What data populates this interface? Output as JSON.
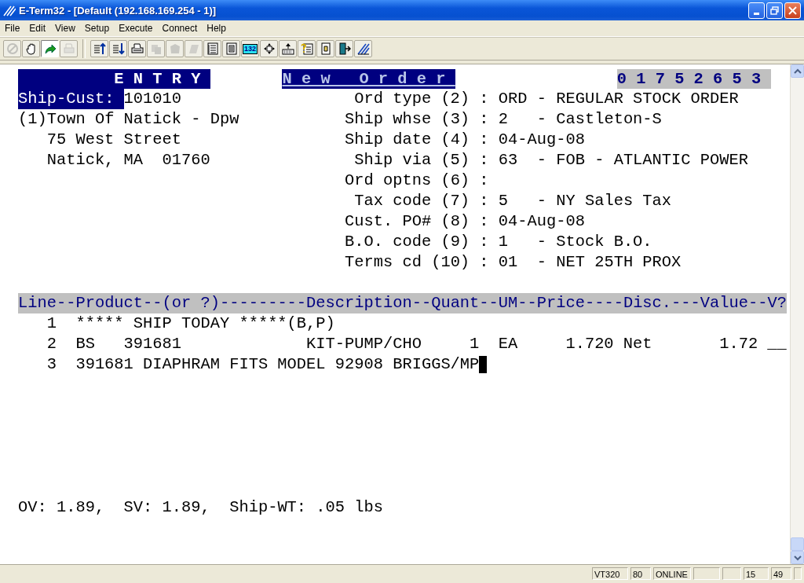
{
  "window": {
    "title": "E-Term32 - [Default (192.168.169.254 - 1)]"
  },
  "menu": [
    "File",
    "Edit",
    "View",
    "Setup",
    "Execute",
    "Connect",
    "Help"
  ],
  "toolbar": {
    "groups": [
      [
        {
          "disabled": true,
          "pressed": false
        },
        {
          "disabled": false,
          "pressed": false
        },
        {
          "disabled": false,
          "pressed": true
        },
        {
          "disabled": true,
          "pressed": false
        }
      ],
      [
        {
          "disabled": false,
          "pressed": false
        },
        {
          "disabled": false,
          "pressed": false
        },
        {
          "disabled": false,
          "pressed": false
        },
        {
          "disabled": true,
          "pressed": false
        },
        {
          "disabled": true,
          "pressed": false
        },
        {
          "disabled": true,
          "pressed": false
        },
        {
          "disabled": false,
          "pressed": false
        },
        {
          "disabled": false,
          "pressed": false
        },
        {
          "disabled": false,
          "pressed": false,
          "label": "132"
        },
        {
          "disabled": false,
          "pressed": false
        },
        {
          "disabled": false,
          "pressed": false
        },
        {
          "disabled": false,
          "pressed": false
        },
        {
          "disabled": false,
          "pressed": false
        },
        {
          "disabled": false,
          "pressed": false
        },
        {
          "disabled": false,
          "pressed": false
        }
      ]
    ]
  },
  "terminal": {
    "banners": [
      "ENTRY",
      "New Order",
      "01752653"
    ],
    "customer": {
      "label": "Ship-Cust:",
      "number": "101010",
      "index": "(1)",
      "name": "Town Of Natick - Dpw",
      "address": [
        "75 West Street",
        "Natick, MA  01760"
      ]
    },
    "fields": [
      {
        "label": "Ord type (2)",
        "separator": ":",
        "value": "ORD - REGULAR STOCK ORDER"
      },
      {
        "label": "Ship whse (3)",
        "separator": ":",
        "value": "2   - Castleton-S"
      },
      {
        "label": "Ship date (4)",
        "separator": ":",
        "value": "04-Aug-08"
      },
      {
        "label": "Ship via (5)",
        "separator": ":",
        "value": "63  - FOB - ATLANTIC POWER"
      },
      {
        "label": "Ord optns (6)",
        "separator": ":"
      },
      {
        "label": "Tax code (7)",
        "separator": ":",
        "value": "5   - NY Sales Tax"
      },
      {
        "label": "Cust. PO# (8)",
        "separator": ":",
        "value": "04-Aug-08"
      },
      {
        "label": "B.O. code (9)",
        "separator": ":",
        "value": "1   - Stock B.O."
      },
      {
        "label": "Terms cd (10)",
        "separator": ":",
        "value": "01  - NET 25TH PROX"
      }
    ],
    "grid_header": "Line--Product--(or ?)---------Description--Quant--UM--Price----Disc.---Value--V?",
    "lines": [
      {
        "kind": "comment",
        "line": "1",
        "text": "***** SHIP TODAY *****(B,P)",
        "cursor": false
      },
      {
        "kind": "item",
        "line": "2",
        "product_type": "BS",
        "product": "391681",
        "description": "KIT-PUMP/CHO",
        "quantity": "1",
        "um": "EA",
        "price": "1.720",
        "disc": "Net",
        "value": "1.72",
        "v": "__"
      },
      {
        "kind": "comment",
        "line": "3",
        "text": "391681 DIAPHRAM FITS MODEL 92908 BRIGGS/MP",
        "cursor": true
      }
    ],
    "totals": "OV: 1.89,  SV: 1.89,  Ship-WT: .05 lbs"
  },
  "status_bar": [
    {
      "text": "VT320"
    },
    {
      "text": "80"
    },
    {
      "text": "ONLINE"
    },
    {
      "blank": true
    },
    {
      "blank": true
    },
    {
      "text": "15"
    },
    {
      "text": "49"
    },
    {
      "blank": true
    }
  ]
}
